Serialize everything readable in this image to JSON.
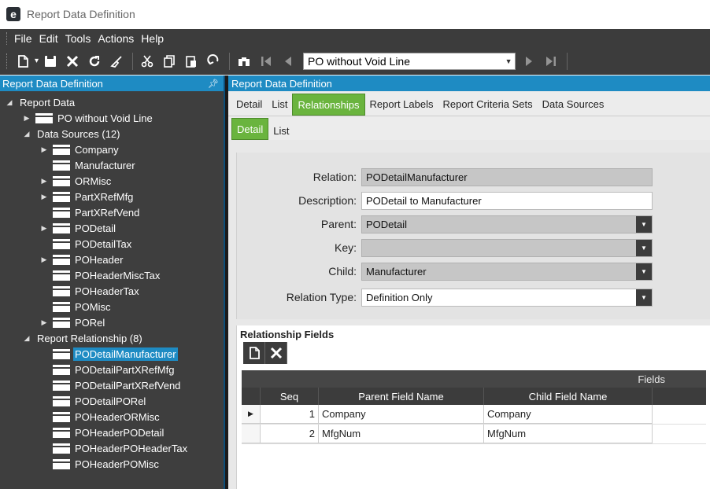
{
  "window": {
    "title": "Report Data Definition",
    "logo": "e"
  },
  "menu": [
    "File",
    "Edit",
    "Tools",
    "Actions",
    "Help"
  ],
  "toolbar": {
    "record_select": "PO without Void Line"
  },
  "left_panel": {
    "header": "Report Data Definition",
    "pin_icon": "pin-icon",
    "tree": [
      {
        "label": "Report Data",
        "level": 0,
        "twisty": "◢",
        "folder": false
      },
      {
        "label": "PO without Void Line",
        "level": 1,
        "twisty": "▶",
        "folder": true
      },
      {
        "label": "Data Sources (12)",
        "level": 1,
        "twisty": "◢",
        "folder": false
      },
      {
        "label": "Company",
        "level": 2,
        "twisty": "▶",
        "folder": true
      },
      {
        "label": "Manufacturer",
        "level": 2,
        "twisty": "",
        "folder": true
      },
      {
        "label": "ORMisc",
        "level": 2,
        "twisty": "▶",
        "folder": true
      },
      {
        "label": "PartXRefMfg",
        "level": 2,
        "twisty": "▶",
        "folder": true
      },
      {
        "label": "PartXRefVend",
        "level": 2,
        "twisty": "",
        "folder": true
      },
      {
        "label": "PODetail",
        "level": 2,
        "twisty": "▶",
        "folder": true
      },
      {
        "label": "PODetailTax",
        "level": 2,
        "twisty": "",
        "folder": true
      },
      {
        "label": "POHeader",
        "level": 2,
        "twisty": "▶",
        "folder": true
      },
      {
        "label": "POHeaderMiscTax",
        "level": 2,
        "twisty": "",
        "folder": true
      },
      {
        "label": "POHeaderTax",
        "level": 2,
        "twisty": "",
        "folder": true
      },
      {
        "label": "POMisc",
        "level": 2,
        "twisty": "",
        "folder": true
      },
      {
        "label": "PORel",
        "level": 2,
        "twisty": "▶",
        "folder": true
      },
      {
        "label": "Report Relationship (8)",
        "level": 1,
        "twisty": "◢",
        "folder": false
      },
      {
        "label": "PODetailManufacturer",
        "level": 2,
        "twisty": "",
        "folder": true,
        "selected": true
      },
      {
        "label": "PODetailPartXRefMfg",
        "level": 2,
        "twisty": "",
        "folder": true
      },
      {
        "label": "PODetailPartXRefVend",
        "level": 2,
        "twisty": "",
        "folder": true
      },
      {
        "label": "PODetailPORel",
        "level": 2,
        "twisty": "",
        "folder": true
      },
      {
        "label": "POHeaderORMisc",
        "level": 2,
        "twisty": "",
        "folder": true
      },
      {
        "label": "POHeaderPODetail",
        "level": 2,
        "twisty": "",
        "folder": true
      },
      {
        "label": "POHeaderPOHeaderTax",
        "level": 2,
        "twisty": "",
        "folder": true
      },
      {
        "label": "POHeaderPOMisc",
        "level": 2,
        "twisty": "",
        "folder": true
      }
    ]
  },
  "right_panel": {
    "header": "Report Data Definition",
    "tabs": [
      "Detail",
      "List",
      "Relationships",
      "Report Labels",
      "Report Criteria Sets",
      "Data Sources"
    ],
    "active_tab": "Relationships",
    "subtabs": [
      "Detail",
      "List"
    ],
    "active_subtab": "Detail",
    "form": {
      "relation_label": "Relation:",
      "relation_value": "PODetailManufacturer",
      "description_label": "Description:",
      "description_value": "PODetail to Manufacturer",
      "parent_label": "Parent:",
      "parent_value": "PODetail",
      "key_label": "Key:",
      "key_value": "",
      "child_label": "Child:",
      "child_value": "Manufacturer",
      "relation_type_label": "Relation Type:",
      "relation_type_value": "Definition Only"
    },
    "relationship_fields": {
      "title": "Relationship Fields",
      "group_header": "Fields",
      "columns": [
        "Seq",
        "Parent Field Name",
        "Child Field Name"
      ],
      "rows": [
        {
          "seq": "1",
          "parent": "Company",
          "child": "Company",
          "current": true
        },
        {
          "seq": "2",
          "parent": "MfgNum",
          "child": "MfgNum",
          "current": false
        }
      ]
    }
  },
  "colors": {
    "accent_blue": "#1e8bc3",
    "tab_green": "#6ab43e",
    "dark_bar": "#3c3c3c"
  }
}
